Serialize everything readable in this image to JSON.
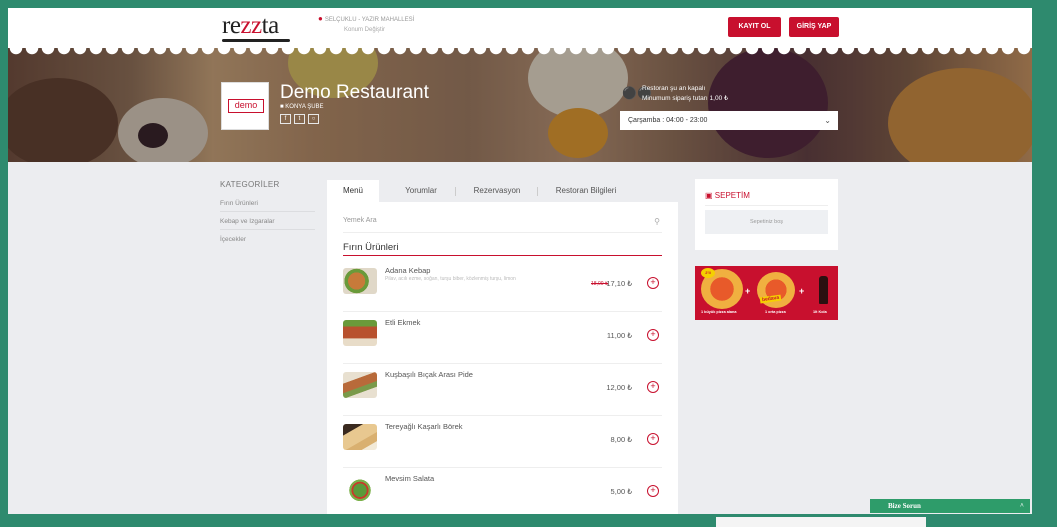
{
  "header": {
    "logo": {
      "pre": "re",
      "z": "zz",
      "post": "ta"
    },
    "location": "SELÇUKLU - YAZIR MAHALLESİ",
    "change_location": "Konum Değiştir",
    "register_label": "KAYIT OL",
    "login_label": "GİRİŞ YAP"
  },
  "restaurant": {
    "logo_text": "demo",
    "name": "Demo Restaurant",
    "branch": "KONYA ŞUBE",
    "status": "Restoran şu an kapalı",
    "min_order": "Minumum sipariş tutarı 1,00 ₺",
    "hours_selected": "Çarşamba : 04:00 - 23:00"
  },
  "categories": {
    "title": "KATEGORİLER",
    "items": [
      "Fırın Ürünleri",
      "Kebap ve Izgaralar",
      "İçecekler"
    ]
  },
  "tabs": [
    "Menü",
    "Yorumlar",
    "Rezervasyon",
    "Restoran Bilgileri"
  ],
  "search": {
    "placeholder": "Yemek Ara"
  },
  "section": {
    "title": "Fırın Ürünleri"
  },
  "menu_items": [
    {
      "name": "Adana Kebap",
      "desc": "Pilav, acılı ezme, soğan, turşu biber, közlenmiş turşu, limon",
      "old_price": "18,00 ₺",
      "price": "17,10 ₺"
    },
    {
      "name": "Etli Ekmek",
      "price": "11,00 ₺"
    },
    {
      "name": "Kuşbaşılı Bıçak Arası Pide",
      "price": "12,00 ₺"
    },
    {
      "name": "Tereyağlı Kaşarlı Börek",
      "price": "8,00 ₺"
    },
    {
      "name": "Mevsim Salata",
      "price": "5,00 ₺"
    }
  ],
  "cart": {
    "title": "SEPETİM",
    "empty": "Sepetiniz boş"
  },
  "promo": {
    "badge": "2'li",
    "word": "bedava",
    "label1": "1 büyük pizza alana",
    "label2": "1 orta pizza",
    "label3": "1lt Kola"
  },
  "chat": {
    "label": "Bize Sorun"
  },
  "icons": {
    "location": "map-pin-icon",
    "building": "building-icon",
    "motorcycle": "motorcycle-icon",
    "search": "search-icon",
    "basket": "basket-icon",
    "add": "plus-circle-icon"
  },
  "colors": {
    "brand": "#c8102e",
    "frame": "#2e8a6e",
    "chat": "#2e9c6a"
  }
}
